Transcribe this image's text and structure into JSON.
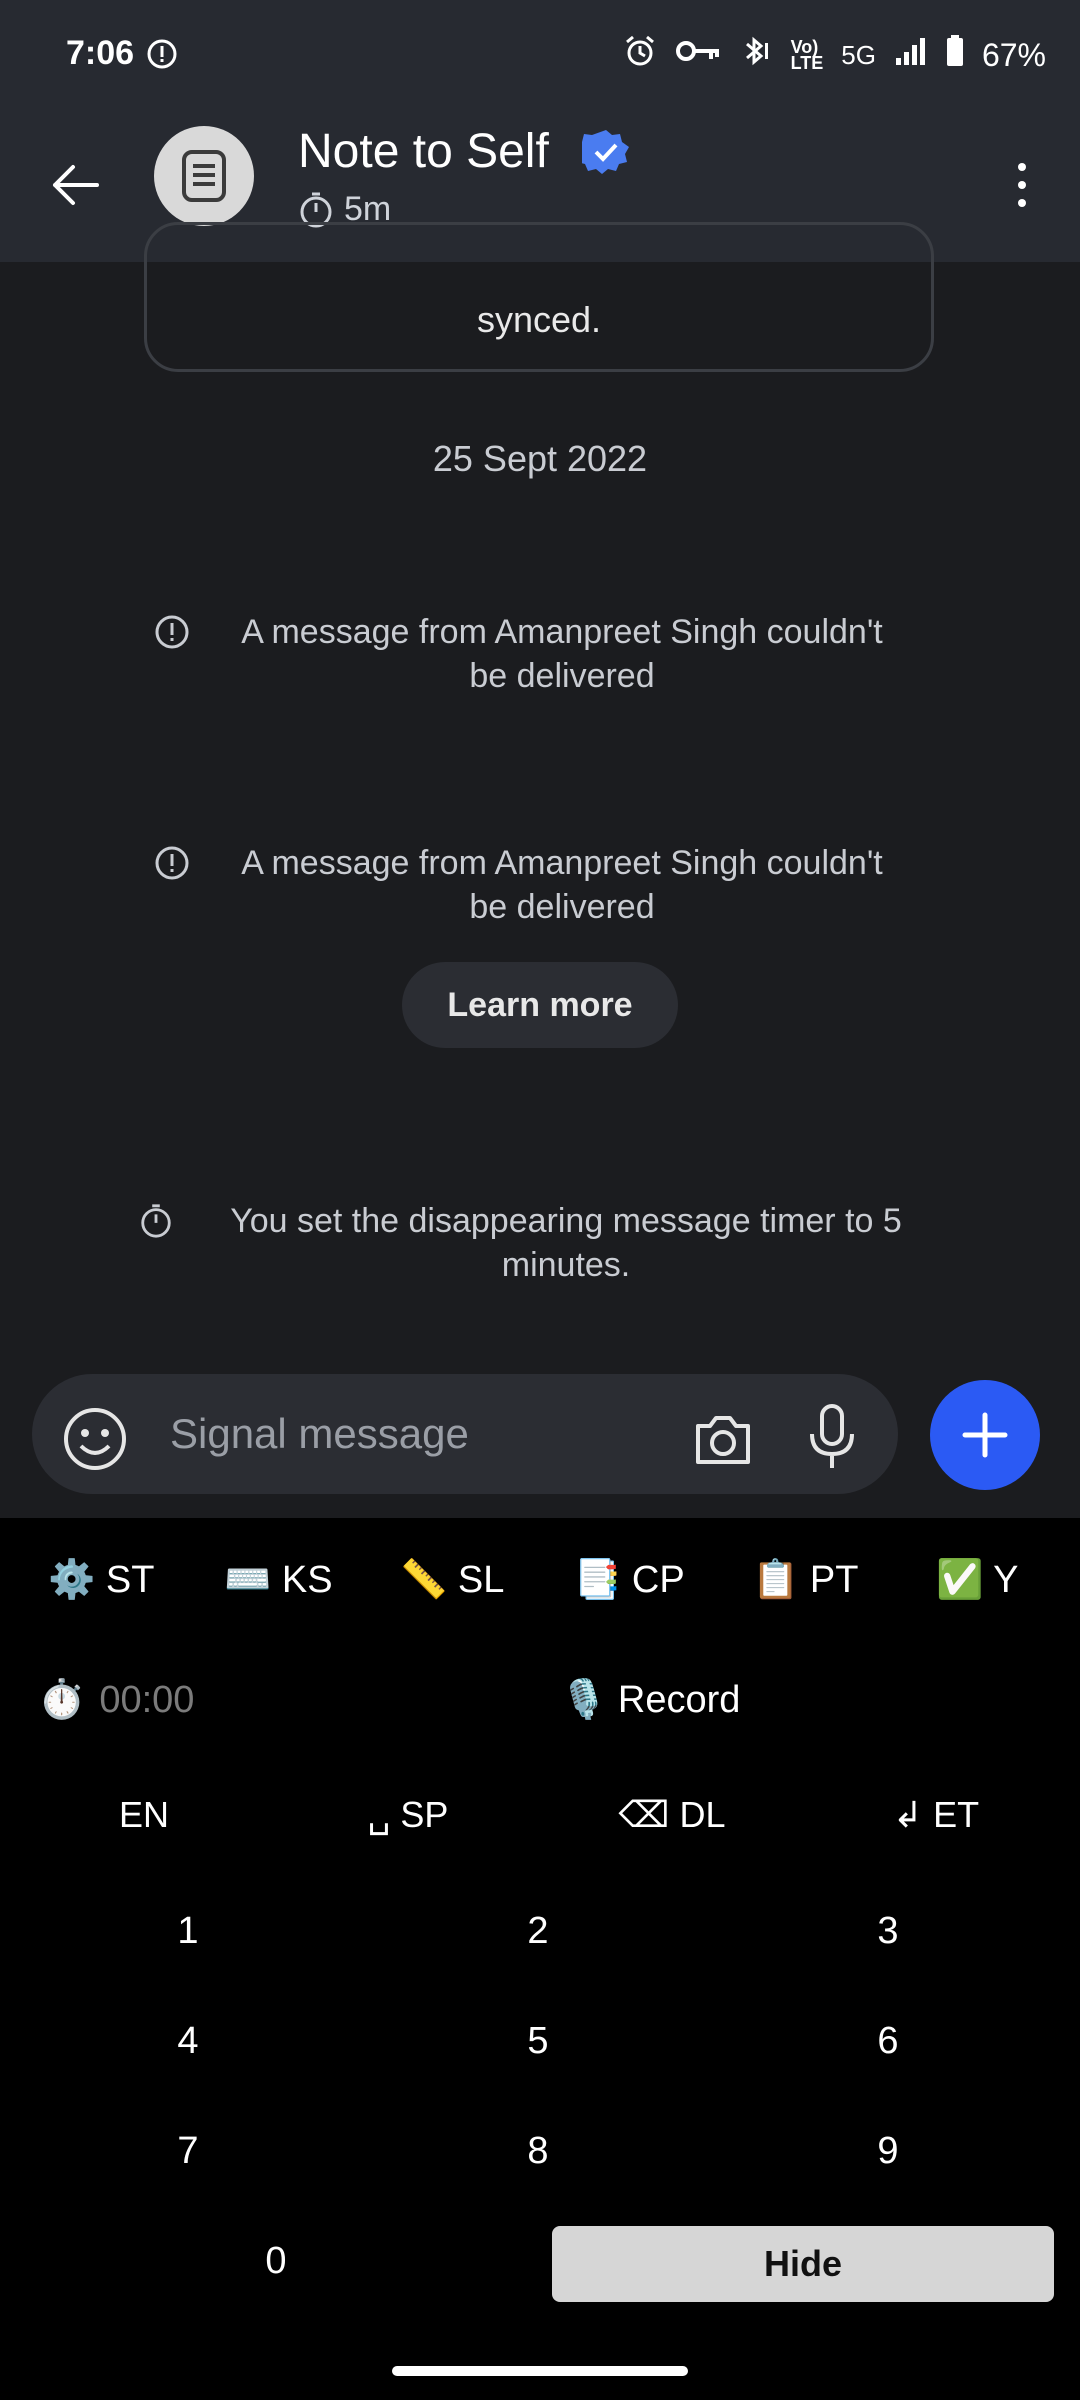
{
  "status_bar": {
    "time": "7:06",
    "battery": "67%",
    "network": "5G",
    "icons": [
      "alert-icon",
      "alarm-icon",
      "vpn-key-icon",
      "bluetooth-icon",
      "volte-icon",
      "signal-icon",
      "battery-icon"
    ]
  },
  "header": {
    "title": "Note to Self",
    "timer_label": "5m",
    "icons": [
      "back-arrow-icon",
      "note-icon",
      "verified-icon",
      "more-vert-icon"
    ]
  },
  "conversation": {
    "previous_message_tail": "synced.",
    "date_divider": "25 Sept 2022",
    "notices": [
      {
        "line1": "A message from Amanpreet Singh couldn't",
        "line2": "be delivered"
      },
      {
        "line1": "A message from Amanpreet Singh couldn't",
        "line2": "be delivered"
      }
    ],
    "learn_more": "Learn more",
    "timer_notice": {
      "line1": "You set the disappearing message timer to 5",
      "line2": "minutes."
    }
  },
  "composer": {
    "placeholder": "Signal message",
    "accent": "#2b5af4"
  },
  "keyboard": {
    "tools": [
      "⚙️ ST",
      "⌨️ KS",
      "📏 SL",
      "📑 CP",
      "📋 PT",
      "✅ Y"
    ],
    "timer": "00:00",
    "record": "🎙️ Record",
    "functions": [
      "EN",
      "␣ SP",
      "⌫ DL",
      "↲ ET"
    ],
    "digits": [
      "1",
      "2",
      "3",
      "4",
      "5",
      "6",
      "7",
      "8",
      "9",
      "0"
    ],
    "hide": "Hide"
  }
}
